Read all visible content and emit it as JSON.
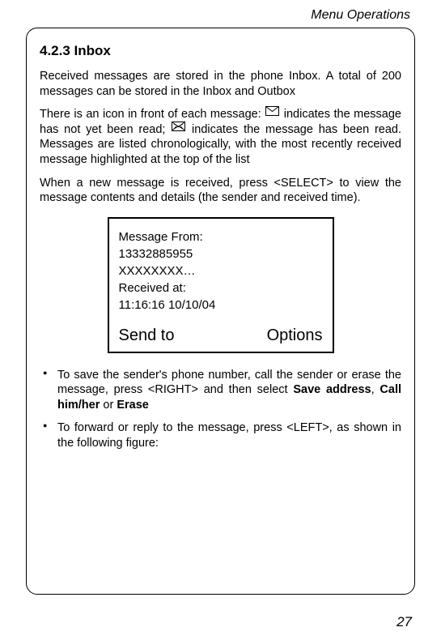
{
  "header": "Menu Operations",
  "section_title": "4.2.3 Inbox",
  "para1": "Received messages are stored in the phone Inbox. A total of 200 messages can be stored in the Inbox and Outbox",
  "para2a": "There is an icon in front of each message: ",
  "para2b": " indicates the message has not yet been read; ",
  "para2c": " indicates the message has been read. Messages are listed chronologically, with the most recently received message highlighted at the top of the list",
  "para3": "When a new message is received, press <SELECT> to view the message contents and details (the sender and received time).",
  "msg": {
    "from_label": "Message From:",
    "from_num": "13332885955",
    "body": "XXXXXXXX…",
    "recv_label": "Received at:",
    "recv_time": "11:16:16 10/10/04",
    "soft_left": "Send to",
    "soft_right": "Options"
  },
  "bullet1a": "To save the sender's phone number, call the sender or erase the message, press <RIGHT> and then select ",
  "bullet1_b1": "Save address",
  "bullet1_sep1": ", ",
  "bullet1_b2": "Call him/her",
  "bullet1_sep2": " or ",
  "bullet1_b3": "Erase",
  "bullet2": "To forward or reply to the message, press <LEFT>, as shown in the following figure:",
  "page_number": "27"
}
